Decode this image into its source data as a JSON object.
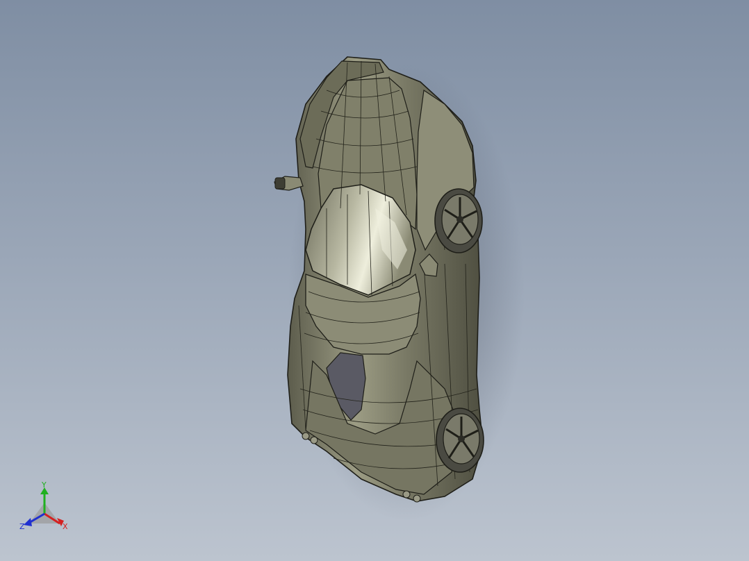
{
  "viewport": {
    "background_top": "#7f8ea3",
    "background_bottom": "#bcc4cf"
  },
  "model": {
    "body_color": "#8a8a72",
    "edge_color": "#1e1e18",
    "highlight_color": "#e4e4d2",
    "shadow_color": "#3a3a30"
  },
  "triad": {
    "x_label": "X",
    "y_label": "Y",
    "z_label": "Z",
    "x_color": "#d42020",
    "y_color": "#20b020",
    "z_color": "#2030d0"
  }
}
